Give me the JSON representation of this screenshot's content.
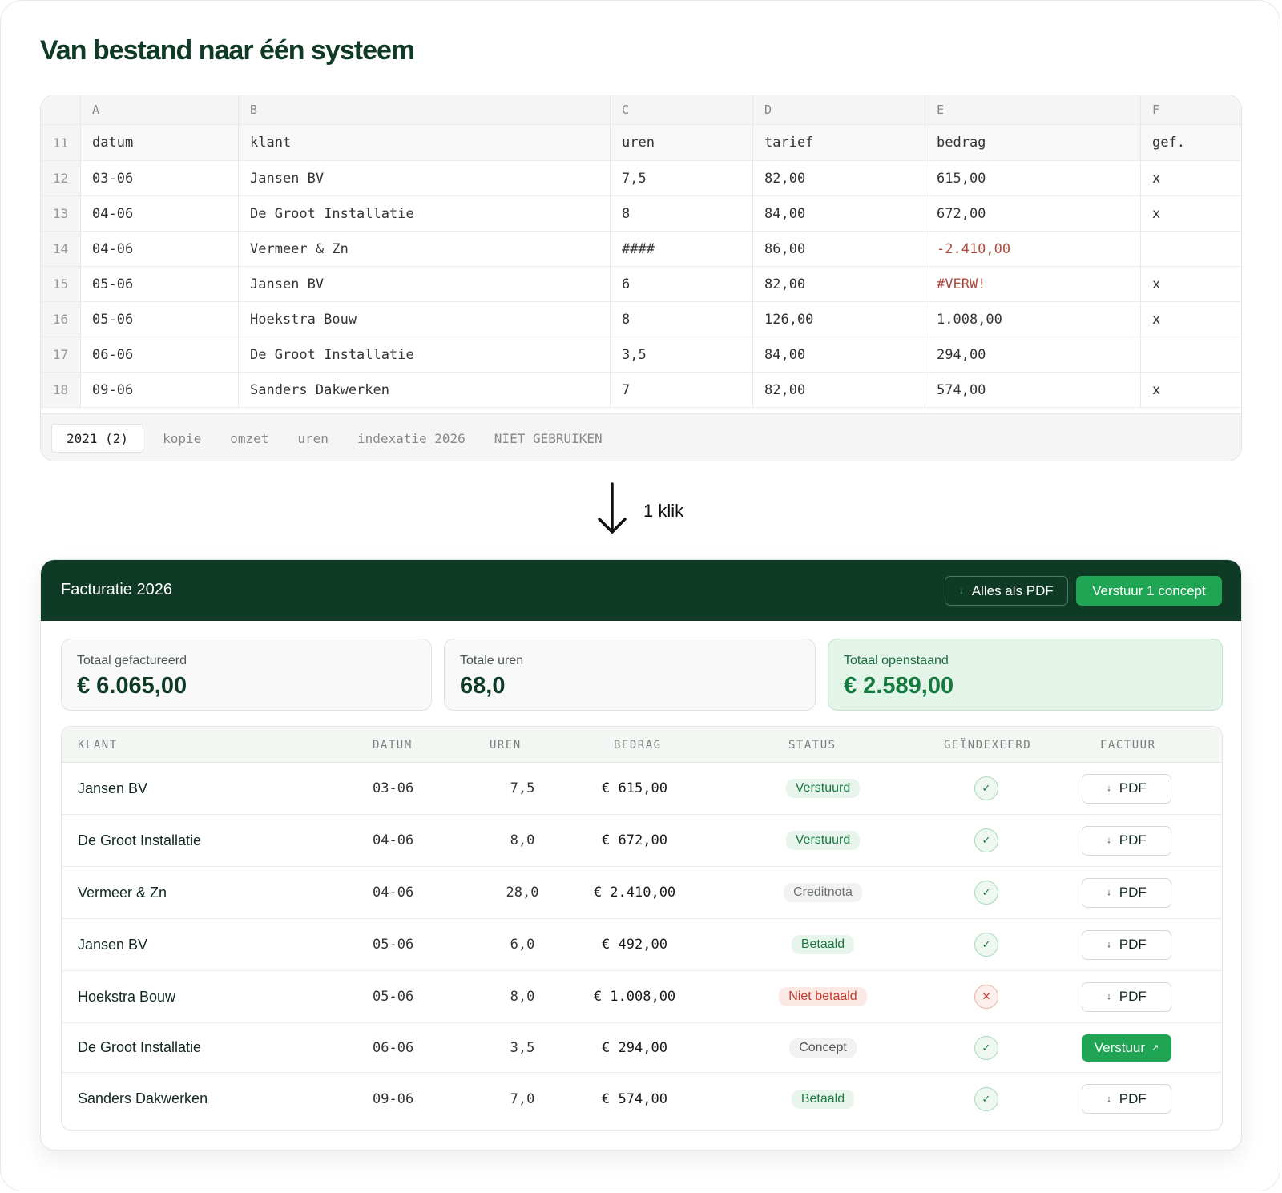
{
  "title": "Van bestand naar één systeem",
  "sheet": {
    "columns": [
      "A",
      "B",
      "C",
      "D",
      "E",
      "F"
    ],
    "header": {
      "row": "11",
      "cells": [
        "datum",
        "klant",
        "uren",
        "tarief",
        "bedrag",
        "gef."
      ]
    },
    "rows": [
      {
        "row": "12",
        "cells": [
          "03-06",
          "Jansen BV",
          "7,5",
          "82,00",
          "615,00",
          "x"
        ]
      },
      {
        "row": "13",
        "cells": [
          "04-06",
          "De Groot Installatie",
          "8",
          "84,00",
          "672,00",
          "x"
        ]
      },
      {
        "row": "14",
        "cells": [
          "04-06",
          "Vermeer & Zn",
          "####",
          "86,00",
          "-2.410,00",
          ""
        ]
      },
      {
        "row": "15",
        "cells": [
          "05-06",
          "Jansen BV",
          "6",
          "82,00",
          "#VERW!",
          "x"
        ]
      },
      {
        "row": "16",
        "cells": [
          "05-06",
          "Hoekstra Bouw",
          "8",
          "126,00",
          "1.008,00",
          "x"
        ]
      },
      {
        "row": "17",
        "cells": [
          "06-06",
          "De Groot Installatie",
          "3,5",
          "84,00",
          "294,00",
          ""
        ]
      },
      {
        "row": "18",
        "cells": [
          "09-06",
          "Sanders Dakwerken",
          "7",
          "82,00",
          "574,00",
          "x"
        ]
      }
    ],
    "tabs": [
      "2021 (2)",
      "kopie",
      "omzet",
      "uren",
      "indexatie 2026",
      "NIET GEBRUIKEN"
    ],
    "active_tab": "2021 (2)"
  },
  "transition": {
    "label": "1 klik",
    "icon": "arrow-down-icon"
  },
  "app": {
    "title": "Facturatie 2026",
    "pdf_all_label": "Alles als PDF",
    "pdf_all_icon": "download-icon",
    "send_concept_label": "Verstuur 1 concept",
    "stats": [
      {
        "label": "Totaal gefactureerd",
        "value": "€ 6.065,00"
      },
      {
        "label": "Totale uren",
        "value": "68,0"
      },
      {
        "label": "Totaal openstaand",
        "value": "€ 2.589,00"
      }
    ],
    "table": {
      "headers": [
        "KLANT",
        "DATUM",
        "UREN",
        "BEDRAG",
        "STATUS",
        "GEÏNDEXEERD",
        "FACTUUR"
      ],
      "rows": [
        {
          "klant": "Jansen BV",
          "datum": "03-06",
          "uren": "7,5",
          "bedrag": "€ 615,00",
          "status": "Verstuurd",
          "status_kind": "sent",
          "geindexeerd": true,
          "action": "PDF"
        },
        {
          "klant": "De Groot Installatie",
          "datum": "04-06",
          "uren": "8,0",
          "bedrag": "€ 672,00",
          "status": "Verstuurd",
          "status_kind": "sent",
          "geindexeerd": true,
          "action": "PDF"
        },
        {
          "klant": "Vermeer & Zn",
          "datum": "04-06",
          "uren": "28,0",
          "bedrag": "€ 2.410,00",
          "status": "Creditnota",
          "status_kind": "credit",
          "geindexeerd": true,
          "action": "PDF"
        },
        {
          "klant": "Jansen BV",
          "datum": "05-06",
          "uren": "6,0",
          "bedrag": "€ 492,00",
          "status": "Betaald",
          "status_kind": "paid",
          "geindexeerd": true,
          "action": "PDF"
        },
        {
          "klant": "Hoekstra Bouw",
          "datum": "05-06",
          "uren": "8,0",
          "bedrag": "€ 1.008,00",
          "status": "Niet betaald",
          "status_kind": "unpaid",
          "geindexeerd": false,
          "action": "PDF"
        },
        {
          "klant": "De Groot Installatie",
          "datum": "06-06",
          "uren": "3,5",
          "bedrag": "€ 294,00",
          "status": "Concept",
          "status_kind": "concept",
          "geindexeerd": true,
          "action": "Verstuur"
        },
        {
          "klant": "Sanders Dakwerken",
          "datum": "09-06",
          "uren": "7,0",
          "bedrag": "€ 574,00",
          "status": "Betaald",
          "status_kind": "paid",
          "geindexeerd": true,
          "action": "PDF"
        }
      ]
    },
    "icons": {
      "check": "✓",
      "cross": "✕",
      "download": "↓",
      "external": "↗"
    },
    "colors": {
      "brand_dark": "#0f3b26",
      "accent_green": "#1fa553",
      "error_red": "#c0392b"
    }
  }
}
